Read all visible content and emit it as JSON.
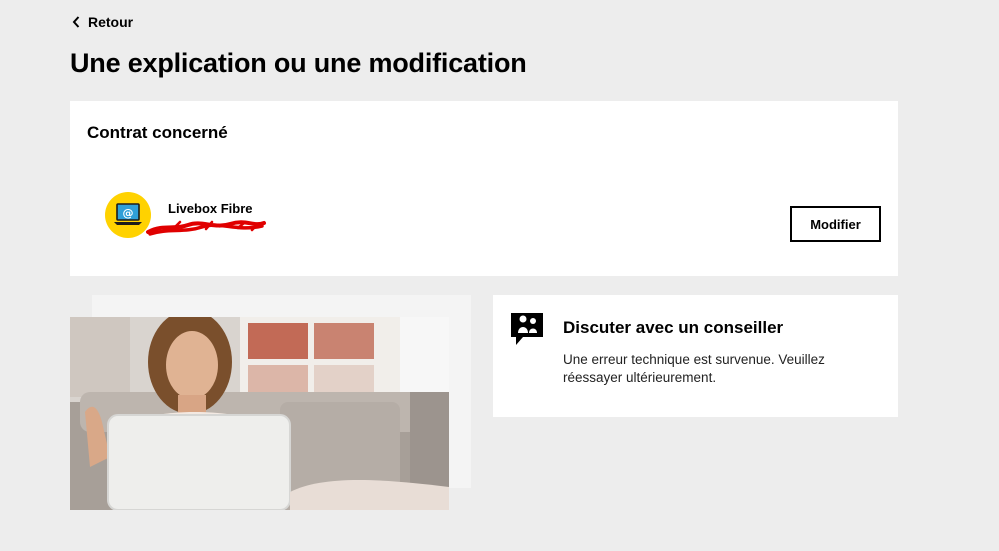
{
  "nav": {
    "back_label": "Retour"
  },
  "page": {
    "title": "Une explication ou une modification"
  },
  "contract": {
    "title": "Contrat concerné",
    "product_name": "Livebox Fibre",
    "modify_label": "Modifier",
    "icon": "laptop-at-icon",
    "accent_color": "#ffd200"
  },
  "chat": {
    "title": "Discuter avec un conseiller",
    "error_message": "Une erreur technique est survenue. Veuillez réessayer ultérieurement.",
    "icon": "chat-advisor-icon"
  },
  "colors": {
    "background": "#ededed",
    "card": "#ffffff",
    "brand_yellow": "#ffd200",
    "redaction": "#e00000"
  }
}
